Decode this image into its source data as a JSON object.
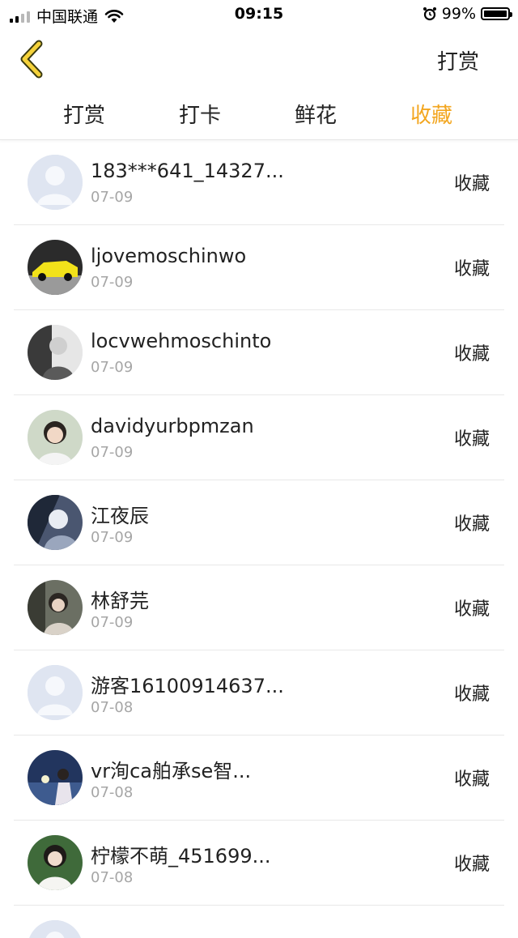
{
  "status_bar": {
    "carrier": "中国联通",
    "time": "09:15",
    "battery": "99%",
    "battery_level": 0.99
  },
  "nav": {
    "back_icon": "chevron-left-icon",
    "action_label": "打赏"
  },
  "tabs": [
    {
      "label": "打赏",
      "active": false
    },
    {
      "label": "打卡",
      "active": false
    },
    {
      "label": "鲜花",
      "active": false
    },
    {
      "label": "收藏",
      "active": true
    }
  ],
  "colors": {
    "accent": "#f3a61f",
    "back_icon": "#f5d23a",
    "text": "#222222",
    "subtext": "#a6a6a6",
    "divider": "#e8e8e8"
  },
  "list": [
    {
      "name": "183***641_14327...",
      "date": "07-09",
      "action": "收藏",
      "avatar": "default-avatar"
    },
    {
      "name": "ljovemoschinwo",
      "date": "07-09",
      "action": "收藏",
      "avatar": "car-photo"
    },
    {
      "name": "locvwehmoschinto",
      "date": "07-09",
      "action": "收藏",
      "avatar": "bw-portrait"
    },
    {
      "name": "davidyurbpmzan",
      "date": "07-09",
      "action": "收藏",
      "avatar": "girl-photo"
    },
    {
      "name": "江夜辰",
      "date": "07-09",
      "action": "收藏",
      "avatar": "anime-portrait"
    },
    {
      "name": "林舒芫",
      "date": "07-09",
      "action": "收藏",
      "avatar": "girl-photo-dark"
    },
    {
      "name": "游客16100914637...",
      "date": "07-08",
      "action": "收藏",
      "avatar": "default-avatar"
    },
    {
      "name": "vr洵ca舶承se智...",
      "date": "07-08",
      "action": "收藏",
      "avatar": "night-photo"
    },
    {
      "name": "柠檬不萌_451699...",
      "date": "07-08",
      "action": "收藏",
      "avatar": "girl-photo-green"
    },
    {
      "name": "",
      "date": "",
      "action": "",
      "avatar": "default-avatar",
      "partial": true
    }
  ]
}
